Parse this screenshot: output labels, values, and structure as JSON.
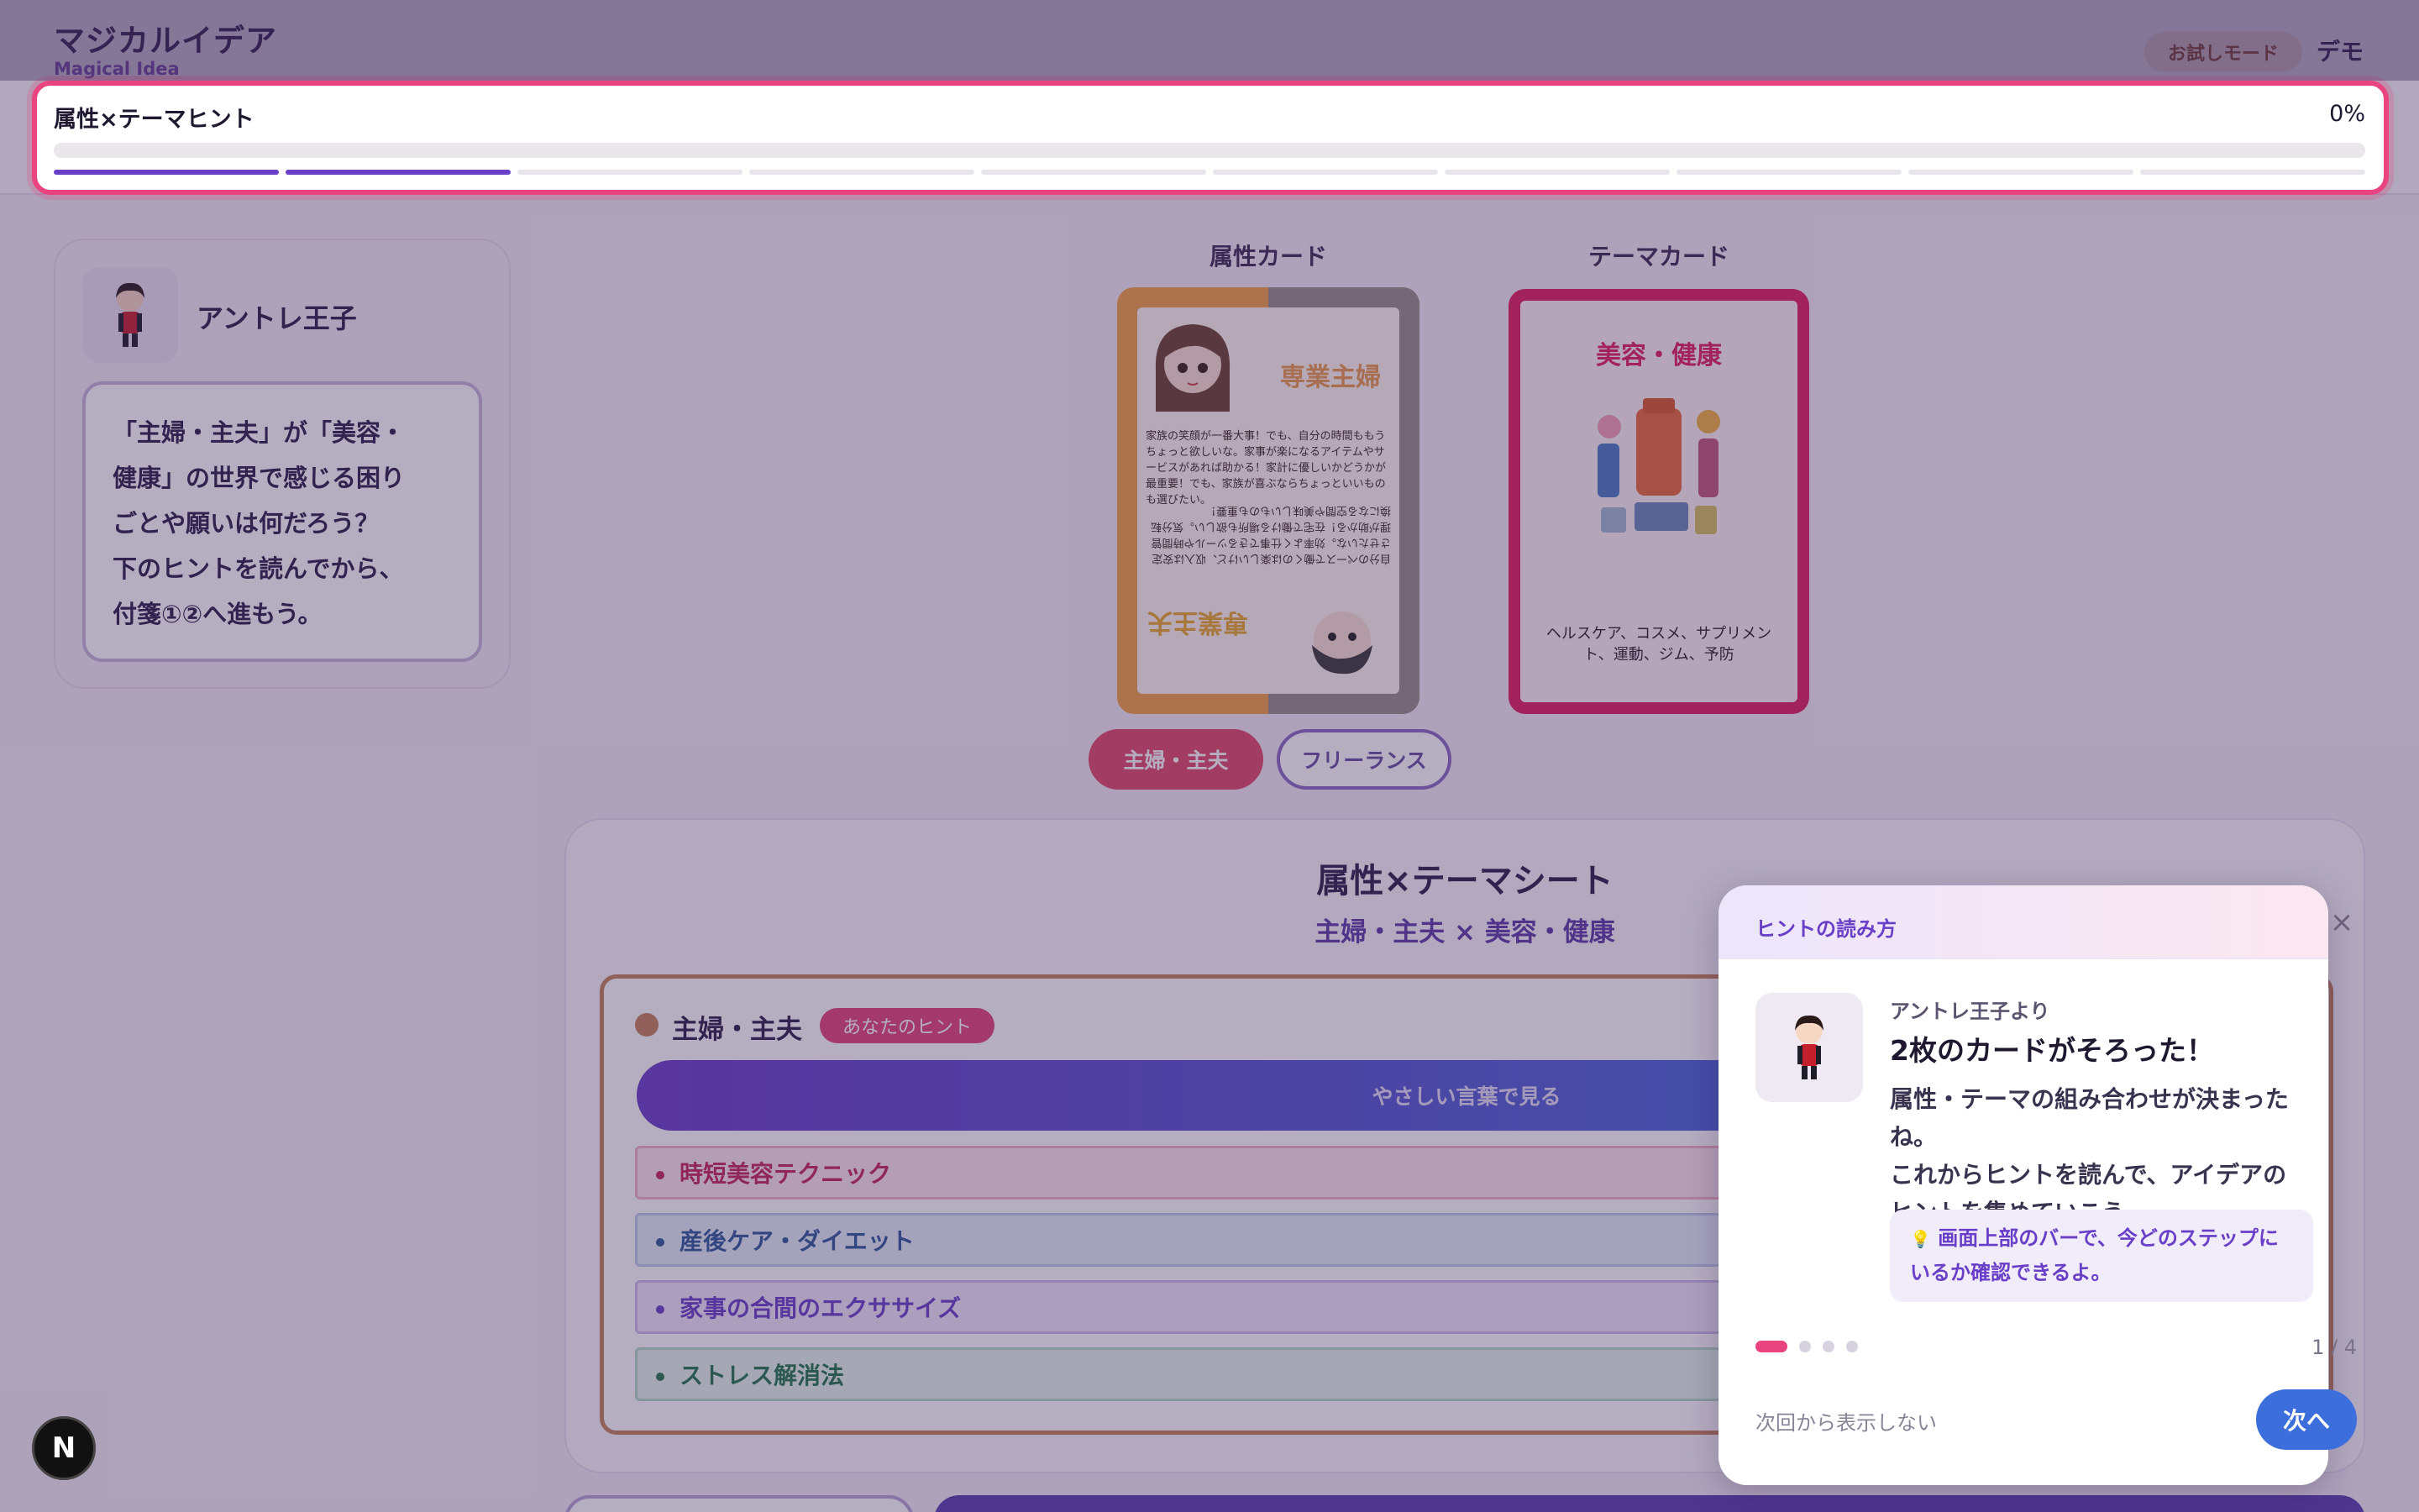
{
  "header": {
    "app_title": "マジカルイデア",
    "app_subtitle": "Magical Idea",
    "trial_badge": "お試しモード",
    "demo_label": "デモ"
  },
  "progress": {
    "title": "属性×テーマヒント",
    "percent_label": "0%",
    "value": 0,
    "steps_total": 10,
    "steps_completed": 2
  },
  "character": {
    "name": "アントレ王子",
    "message_lines": [
      "「主婦・主夫」が「美容・",
      "健康」の世界で感じる困り",
      "ごとや願いは何だろう？",
      "下のヒントを読んでから、",
      "付箋①②へ進もう。"
    ]
  },
  "cards": {
    "attribute_label": "属性カード",
    "theme_label": "テーマカード",
    "attribute_card_title": "専業主婦",
    "attribute_card_text": "家族の笑顔が一番大事！でも、自分の時間ももうちょっと欲しいな。家事が楽になるアイテムやサービスがあれば助かる！家計に優しいかどうかが最重要！でも、家族が喜ぶならちょっといいものも選びたい。",
    "attribute_card_title_bottom": "専業主夫",
    "attribute_card_text_bottom": "自分のペースで働くのは楽しいけど、収入は安定させたいな。効率よく仕事できるツールや時間管理が助かる！在宅で働ける場所も欲しい。気分転換になる空間や美味しいものも重要！",
    "theme_card_title": "美容・健康",
    "theme_card_text": "ヘルスケア、コスメ、サプリメント、運動、ジム、予防"
  },
  "chips": {
    "housewife": "主婦・主夫",
    "freelance": "フリーランス"
  },
  "sheet": {
    "title": "属性×テーマシート",
    "subtitle": "主婦・主夫 × 美容・健康",
    "hint_heading": "主婦・主夫",
    "hint_badge": "あなたのヒント",
    "easy_button": "やさしい言葉で見る",
    "hints": [
      "時短美容テクニック",
      "産後ケア・ダイエット",
      "家事の合間のエクササイズ",
      "ストレス解消法"
    ]
  },
  "popup": {
    "title": "ヒントの読み方",
    "close_icon": "close-icon",
    "from": "アントレ王子より",
    "heading": "2枚のカードがそろった！",
    "body_lines": [
      "属性・テーマの組み合わせが決まったね。",
      "これからヒントを読んで、アイデアの",
      "ヒントを集めていこう。"
    ],
    "tip_icon": "💡",
    "tip": "画面上部のバーで、今どのステップにいるか確認できるよ。",
    "page": "1 / 4",
    "current_page": 1,
    "total_pages": 4,
    "dont_show": "次回から表示しない",
    "next": "次へ"
  },
  "badge": {
    "label": "N"
  },
  "colors": {
    "accent": "#6a3fc8",
    "highlight": "#e9447f",
    "primary_button": "#3d6fdc"
  }
}
